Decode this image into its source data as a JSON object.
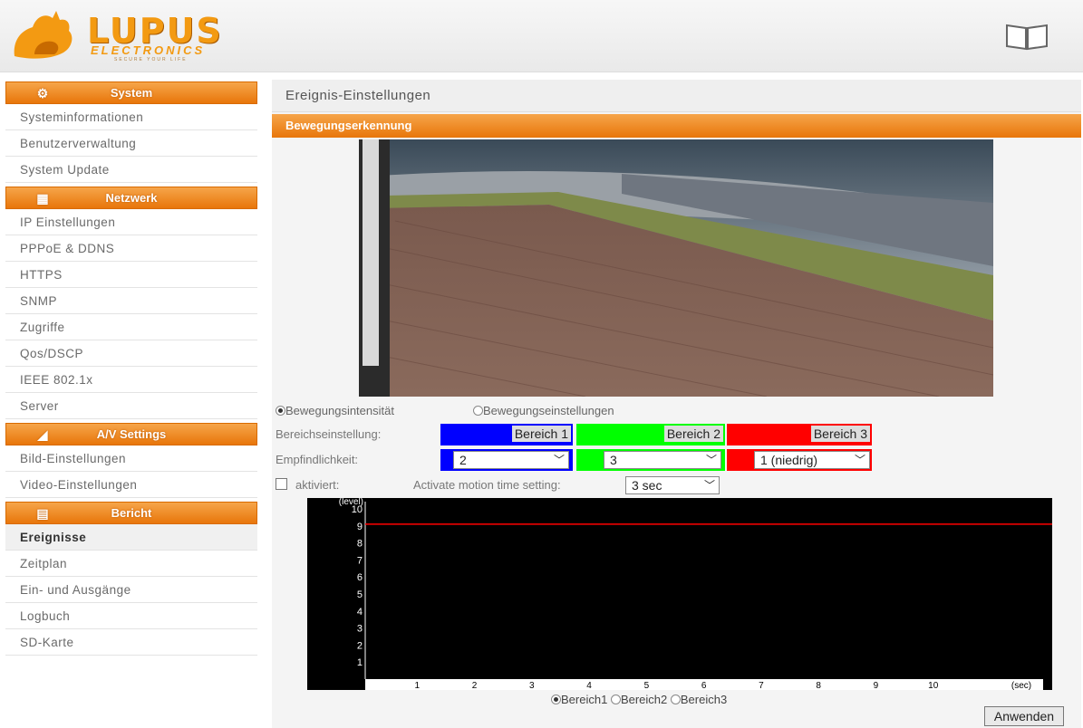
{
  "header": {
    "brand": "LUPUS",
    "brand_sub": "ELECTRONICS",
    "tagline": "SECURE YOUR LIFE",
    "help_icon": "book-icon"
  },
  "sidebar": {
    "sections": [
      {
        "title": "System",
        "icon": "gear-icon",
        "items": [
          "Systeminformationen",
          "Benutzerverwaltung",
          "System Update"
        ]
      },
      {
        "title": "Netzwerk",
        "icon": "network-icon",
        "items": [
          "IP Einstellungen",
          "PPPoE & DDNS",
          "HTTPS",
          "SNMP",
          "Zugriffe",
          "Qos/DSCP",
          "IEEE 802.1x",
          "Server"
        ]
      },
      {
        "title": "A/V Settings",
        "icon": "camera-icon",
        "items": [
          "Bild-Einstellungen",
          "Video-Einstellungen"
        ]
      },
      {
        "title": "Bericht",
        "icon": "report-icon",
        "items": [
          "Ereignisse",
          "Zeitplan",
          "Ein- und Ausgänge",
          "Logbuch",
          "SD-Karte"
        ]
      }
    ],
    "active": "Ereignisse"
  },
  "main": {
    "title": "Ereignis-Einstellungen",
    "section": "Bewegungserkennung",
    "mode_options": [
      "Bewegungsintensität",
      "Bewegungseinstellungen"
    ],
    "mode_selected": "Bewegungsintensität",
    "area_label": "Bereichseinstellung:",
    "areas": [
      {
        "label": "Bereich 1",
        "color": "#0000ff",
        "sensitivity": "2"
      },
      {
        "label": "Bereich 2",
        "color": "#00ff00",
        "sensitivity": "3"
      },
      {
        "label": "Bereich 3",
        "color": "#ff0000",
        "sensitivity": "1 (niedrig)"
      }
    ],
    "sensitivity_label": "Empfindlichkeit:",
    "activated_label": "aktiviert:",
    "activated": false,
    "motion_time_label": "Activate motion time setting:",
    "motion_time_value": "3 sec",
    "chart_area_options": [
      "Bereich1",
      "Bereich2",
      "Bereich3"
    ],
    "chart_area_selected": "Bereich1",
    "apply_label": "Anwenden"
  },
  "chart_data": {
    "type": "line",
    "ylabel": "(level)",
    "xlabel": "(sec)",
    "y_ticks": [
      1,
      2,
      3,
      4,
      5,
      6,
      7,
      8,
      9,
      10
    ],
    "x_ticks": [
      1,
      2,
      3,
      4,
      5,
      6,
      7,
      8,
      9,
      10
    ],
    "ylim": [
      0,
      10
    ],
    "xlim": [
      0,
      11
    ],
    "threshold": 9.1,
    "threshold_color": "#ff0000",
    "series": []
  }
}
